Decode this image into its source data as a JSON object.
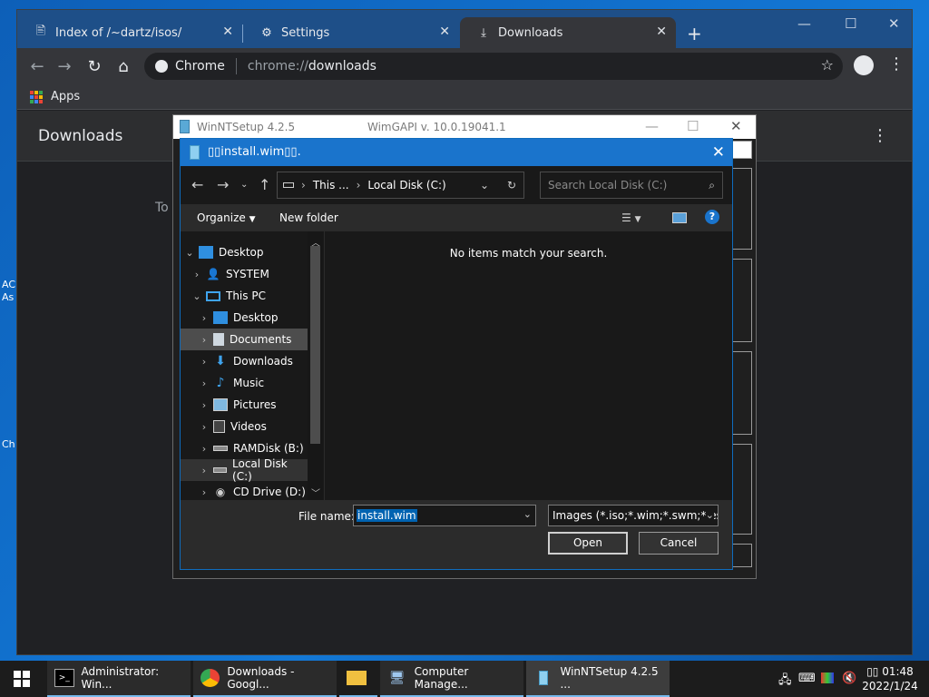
{
  "desktop": {
    "fragments": [
      "AC",
      "As",
      "Ch"
    ]
  },
  "chrome": {
    "tabs": [
      {
        "label": "Index of /~dartz/isos/",
        "icon": "page-icon"
      },
      {
        "label": "Settings",
        "icon": "gear-icon"
      },
      {
        "label": "Downloads",
        "icon": "download-icon"
      }
    ],
    "omnibox": {
      "chip": "Chrome",
      "url_prefix": "chrome://",
      "url_path": "downloads"
    },
    "bookmarks": {
      "apps_label": "Apps"
    },
    "downloads_page": {
      "title": "Downloads",
      "fragment_text": "To"
    }
  },
  "winntsetup": {
    "title": "WinNTSetup 4.2.5",
    "wimgapi": "WimGAPI v. 10.0.19041.1"
  },
  "dialog": {
    "title": "▯▯install.wim▯▯.",
    "address": {
      "crumb1": "This ...",
      "crumb2": "Local Disk (C:)"
    },
    "search_placeholder": "Search Local Disk (C:)",
    "commands": {
      "organize": "Organize",
      "new_folder": "New folder"
    },
    "nav_tree": [
      {
        "label": "Desktop",
        "icon": "desktop-icon",
        "expanded": true
      },
      {
        "label": "SYSTEM",
        "icon": "user-icon",
        "expanded": false
      },
      {
        "label": "This PC",
        "icon": "pc-icon",
        "expanded": true
      },
      {
        "label": "Desktop",
        "icon": "desktop-icon",
        "expanded": false
      },
      {
        "label": "Documents",
        "icon": "documents-icon",
        "expanded": false,
        "selected": true
      },
      {
        "label": "Downloads",
        "icon": "download-arrow-icon",
        "expanded": false
      },
      {
        "label": "Music",
        "icon": "music-icon",
        "expanded": false
      },
      {
        "label": "Pictures",
        "icon": "pictures-icon",
        "expanded": false
      },
      {
        "label": "Videos",
        "icon": "videos-icon",
        "expanded": false
      },
      {
        "label": "RAMDisk (B:)",
        "icon": "drive-icon",
        "expanded": false
      },
      {
        "label": "Local Disk (C:)",
        "icon": "drive-icon",
        "expanded": false,
        "selected": true
      },
      {
        "label": "CD Drive (D:)",
        "icon": "cd-drive-icon",
        "expanded": false
      }
    ],
    "empty_message": "No items match your search.",
    "file_name_label": "File name:",
    "file_name_value": "install.wim",
    "filter_value": "Images (*.iso;*.wim;*.swm;*.esd)",
    "open_label": "Open",
    "cancel_label": "Cancel"
  },
  "taskbar": {
    "items": [
      {
        "label": "Administrator: Win...",
        "icon": "cmd-icon"
      },
      {
        "label": "Downloads - Googl...",
        "icon": "chrome-icon"
      },
      {
        "label": "",
        "icon": "folder-icon"
      },
      {
        "label": "Computer Manage...",
        "icon": "computer-management-icon"
      },
      {
        "label": "WinNTSetup 4.2.5  ...",
        "icon": "winntsetup-icon"
      }
    ],
    "clock_time": "▯▯ 01:48",
    "clock_date": "2022/1/24"
  },
  "colors": {
    "accent": "#1a74cc",
    "desktop": "#1378d6",
    "dark_bg": "#191919"
  }
}
